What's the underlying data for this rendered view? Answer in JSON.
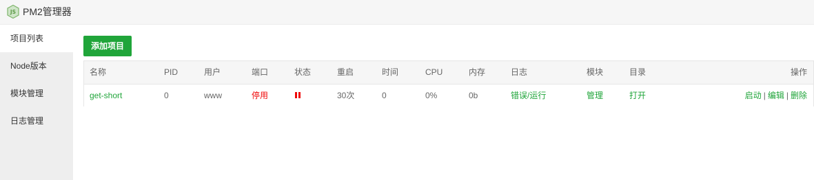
{
  "app": {
    "title": "PM2管理器",
    "logo_text": "JS"
  },
  "sidebar": {
    "items": [
      {
        "label": "项目列表",
        "active": true
      },
      {
        "label": "Node版本"
      },
      {
        "label": "模块管理"
      },
      {
        "label": "日志管理"
      }
    ]
  },
  "toolbar": {
    "add_label": "添加项目"
  },
  "table": {
    "headers": [
      "名称",
      "PID",
      "用户",
      "端口",
      "状态",
      "重启",
      "时间",
      "CPU",
      "内存",
      "日志",
      "模块",
      "目录",
      "操作"
    ],
    "rows": [
      {
        "name": "get-short",
        "pid": "0",
        "user": "www",
        "port": "停用",
        "status_icon": "pause-icon",
        "restarts": "30次",
        "time": "0",
        "cpu": "0%",
        "memory": "0b",
        "log": "错误/运行",
        "module": "管理",
        "dir": "打开",
        "actions": {
          "start": "启动",
          "edit": "编辑",
          "delete": "删除",
          "separator": "|"
        }
      }
    ]
  },
  "colors": {
    "accent": "#20a53a",
    "danger": "#ef0808",
    "sidebar_bg": "#eeeeee",
    "header_bg": "#f6f6f6"
  }
}
